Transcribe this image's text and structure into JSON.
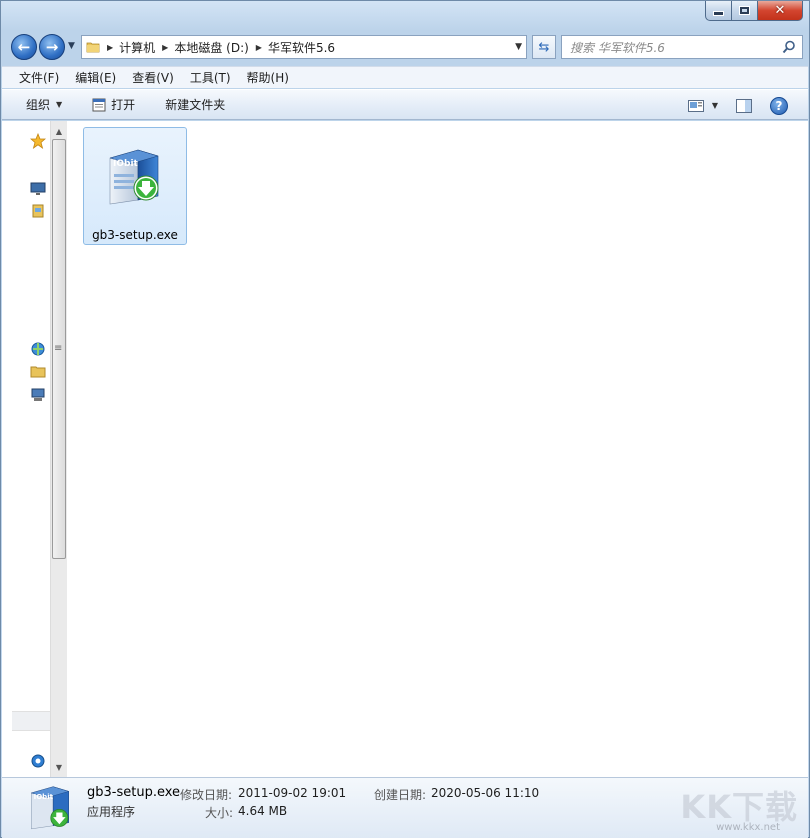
{
  "window": {
    "minimize_glyph": "",
    "close_glyph": "x"
  },
  "nav": {
    "breadcrumbs": [
      "计算机",
      "本地磁盘 (D:)",
      "华军软件5.6"
    ]
  },
  "search": {
    "placeholder": "搜索 华军软件5.6"
  },
  "menu": [
    "文件(F)",
    "编辑(E)",
    "查看(V)",
    "工具(T)",
    "帮助(H)"
  ],
  "toolbar": {
    "organize": "组织",
    "open": "打开",
    "new_folder": "新建文件夹"
  },
  "files": [
    {
      "name": "gb3-setup.exe",
      "icon": "iobit-installer-icon"
    }
  ],
  "details": {
    "name": "gb3-setup.exe",
    "type": "应用程序",
    "modified_label": "修改日期:",
    "modified_value": "2011-09-02 19:01",
    "created_label": "创建日期:",
    "created_value": "2020-05-06 11:10",
    "size_label": "大小:",
    "size_value": "4.64 MB"
  },
  "icon_text": "IObit",
  "watermark": {
    "main": "KK下载",
    "sub": "www.kkx.net"
  },
  "colors": {
    "selection": "#d6e9fb",
    "selection_border": "#8fbce6",
    "chrome": "#c9dcef",
    "close": "#c3321b"
  }
}
